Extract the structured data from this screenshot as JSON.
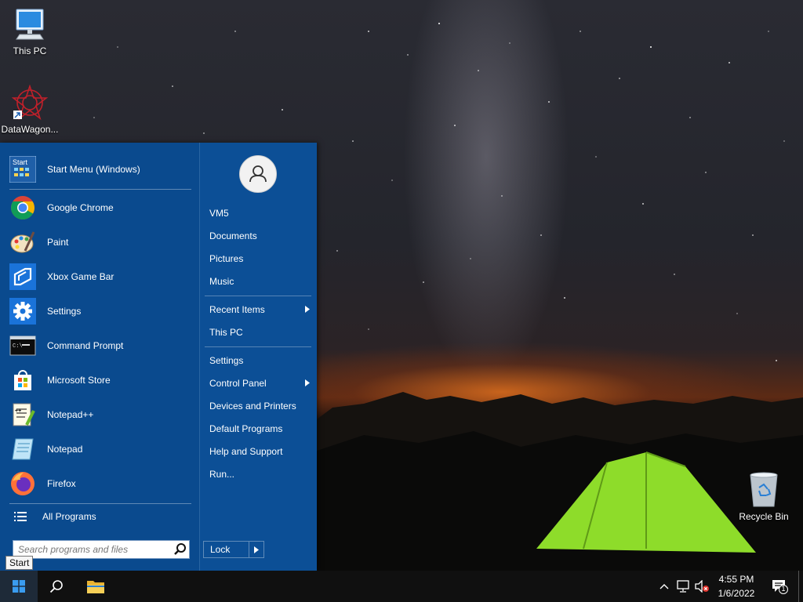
{
  "desktop": {
    "icons": [
      {
        "label": "This PC",
        "icon": "computer-icon"
      },
      {
        "label": "DataWagon...",
        "icon": "datawagon-shortcut-icon"
      },
      {
        "label": "Recycle Bin",
        "icon": "recycle-bin-icon"
      }
    ]
  },
  "start_menu": {
    "programs": [
      {
        "label": "Start Menu (Windows)",
        "icon": "start-menu-app-icon"
      },
      {
        "label": "Google Chrome",
        "icon": "chrome-icon"
      },
      {
        "label": "Paint",
        "icon": "paint-icon"
      },
      {
        "label": "Xbox Game Bar",
        "icon": "xbox-game-bar-icon"
      },
      {
        "label": "Settings",
        "icon": "gear-icon"
      },
      {
        "label": "Command Prompt",
        "icon": "command-prompt-icon"
      },
      {
        "label": "Microsoft Store",
        "icon": "store-icon"
      },
      {
        "label": "Notepad++",
        "icon": "notepadpp-icon"
      },
      {
        "label": "Notepad",
        "icon": "notepad-icon"
      },
      {
        "label": "Firefox",
        "icon": "firefox-icon"
      }
    ],
    "start_menu_icon_text": "Start",
    "all_programs": "All Programs",
    "search_placeholder": "Search programs and files",
    "user": {
      "name": "VM5"
    },
    "right_items": {
      "documents": "Documents",
      "pictures": "Pictures",
      "music": "Music",
      "recent_items": "Recent Items",
      "this_pc": "This PC",
      "settings": "Settings",
      "control_panel": "Control Panel",
      "devices_printers": "Devices and Printers",
      "default_programs": "Default Programs",
      "help_support": "Help and Support",
      "run": "Run..."
    },
    "lock_label": "Lock",
    "start_tooltip": "Start"
  },
  "taskbar": {
    "time": "4:55 PM",
    "date": "1/6/2022",
    "notification_count": "1"
  },
  "colors": {
    "menu_bg": "#0a4a8e",
    "right_pane_bg": "#0c4f96",
    "taskbar_bg": "#101010",
    "tent_green": "#8edc2a"
  }
}
